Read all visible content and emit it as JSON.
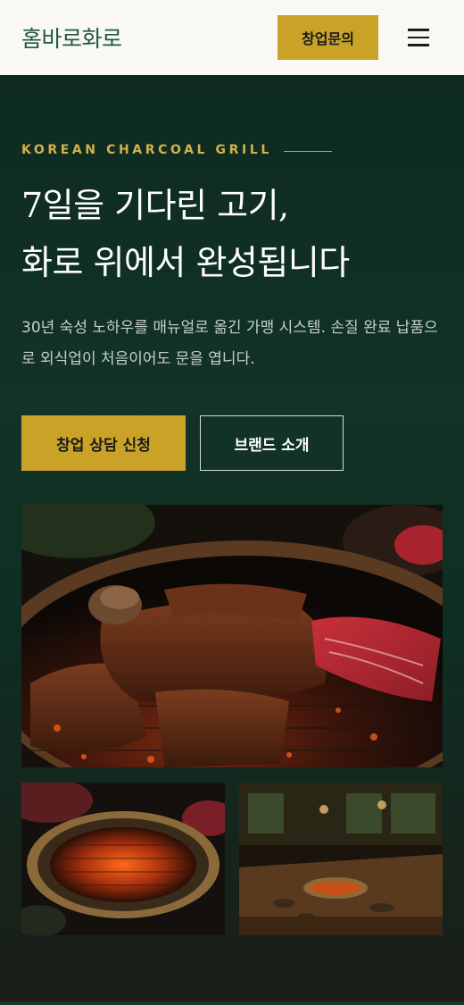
{
  "header": {
    "brand": "홈바로화로",
    "inquiry_label": "창업문의",
    "menu_icon": "hamburger-menu-icon"
  },
  "hero": {
    "eyebrow": "KOREAN CHARCOAL GRILL",
    "headline_line1": "7일을 기다린 고기,",
    "headline_line2": "화로 위에서 완성됩니다",
    "description": "30년 숙성 노하우를 매뉴얼로 옮긴 가맹 시스템. 손질 완료 납품으로 외식업이 처음이어도 문을 엽니다.",
    "cta_primary": "창업 상담 신청",
    "cta_secondary": "브랜드 소개"
  },
  "gallery": {
    "main_photo": "grilled-beef-on-charcoal-photo",
    "photo_2": "charcoal-grill-photo",
    "photo_3": "restaurant-interior-photo"
  },
  "colors": {
    "accent_gold": "#c9a227",
    "brand_green": "#1f5a3e",
    "hero_bg": "#0f2a22",
    "header_bg": "#faf8f2"
  }
}
